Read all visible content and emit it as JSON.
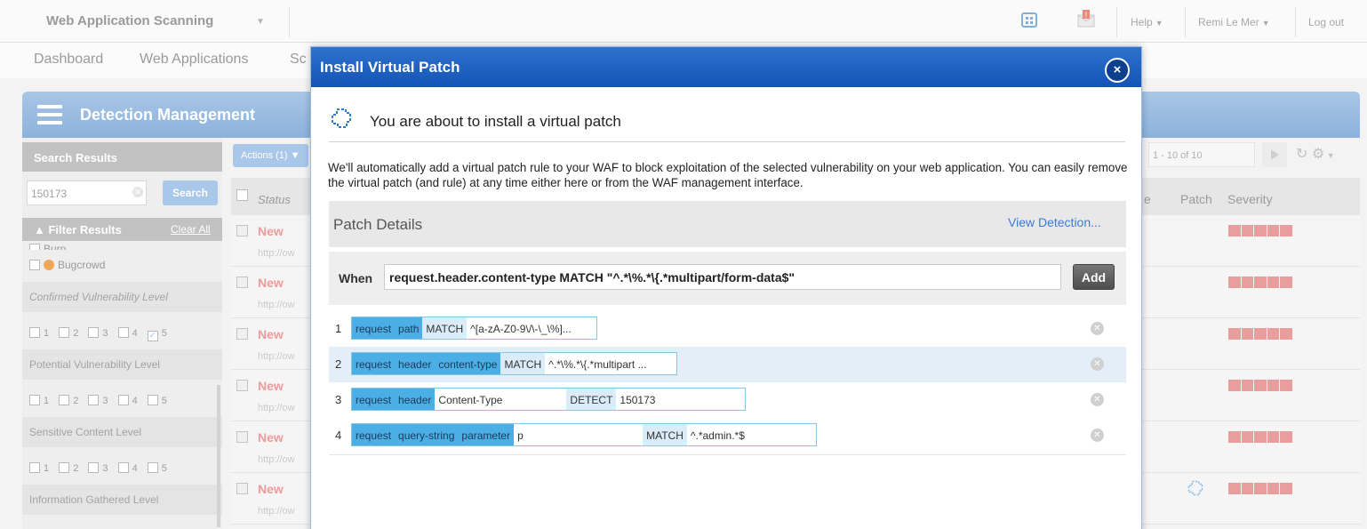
{
  "app": {
    "title": "Web Application Scanning",
    "help": "Help",
    "user": "Remi Le Mer",
    "logout": "Log out"
  },
  "nav": {
    "items": [
      "Dashboard",
      "Web Applications",
      "Sc"
    ]
  },
  "panel": {
    "title": "Detection Management"
  },
  "sidebar": {
    "search_results": "Search Results",
    "search_value": "150173",
    "search_button": "Search",
    "filter_results": "Filter Results",
    "clear_all": "Clear All",
    "burp": "Burp",
    "bugcrowd": "Bugcrowd",
    "confirmed_level": "Confirmed Vulnerability Level",
    "potential_level": "Potential Vulnerability Level",
    "sensitive_level": "Sensitive Content Level",
    "info_level": "Information Gathered Level",
    "levels": [
      "1",
      "2",
      "3",
      "4",
      "5"
    ]
  },
  "toolbar": {
    "actions": "Actions (1)",
    "pager": "1 - 10 of 10"
  },
  "table": {
    "col_status": "Status",
    "col_e": "e",
    "col_patch": "Patch",
    "col_severity": "Severity",
    "row_status": "New",
    "row_url": "http://ow"
  },
  "modal": {
    "title": "Install Virtual Patch",
    "close": "×",
    "about": "You are about to install a virtual patch",
    "description": "We'll automatically add a virtual patch rule to your WAF to block exploitation of the selected vulnerability on your web application. You can easily remove the virtual patch (and rule) at any time either here or from the WAF management interface.",
    "patch_details": "Patch Details",
    "view_detection": "View Detection...",
    "when_label": "When",
    "when_value": "request.header.content-type MATCH \"^.*\\%.*\\{.*multipart/form-data$\"",
    "add": "Add",
    "rules": [
      {
        "num": "1",
        "tokens": [
          "request",
          "path",
          "MATCH",
          "^[a-zA-Z0-9\\/\\-\\_\\%]..."
        ]
      },
      {
        "num": "2",
        "tokens": [
          "request",
          "header",
          "content-type",
          "MATCH",
          "^.*\\%.*\\{.*multipart ..."
        ]
      },
      {
        "num": "3",
        "tokens": [
          "request",
          "header",
          "Content-Type",
          "DETECT",
          "150173"
        ]
      },
      {
        "num": "4",
        "tokens": [
          "request",
          "query-string",
          "parameter",
          "p",
          "MATCH",
          "^.*admin.*$"
        ]
      }
    ]
  },
  "colors": {
    "modal_header": "#1453b6",
    "token_blue": "#4bafe6",
    "severity": "#ea9d9d",
    "status_new": "#ef9b9b"
  }
}
